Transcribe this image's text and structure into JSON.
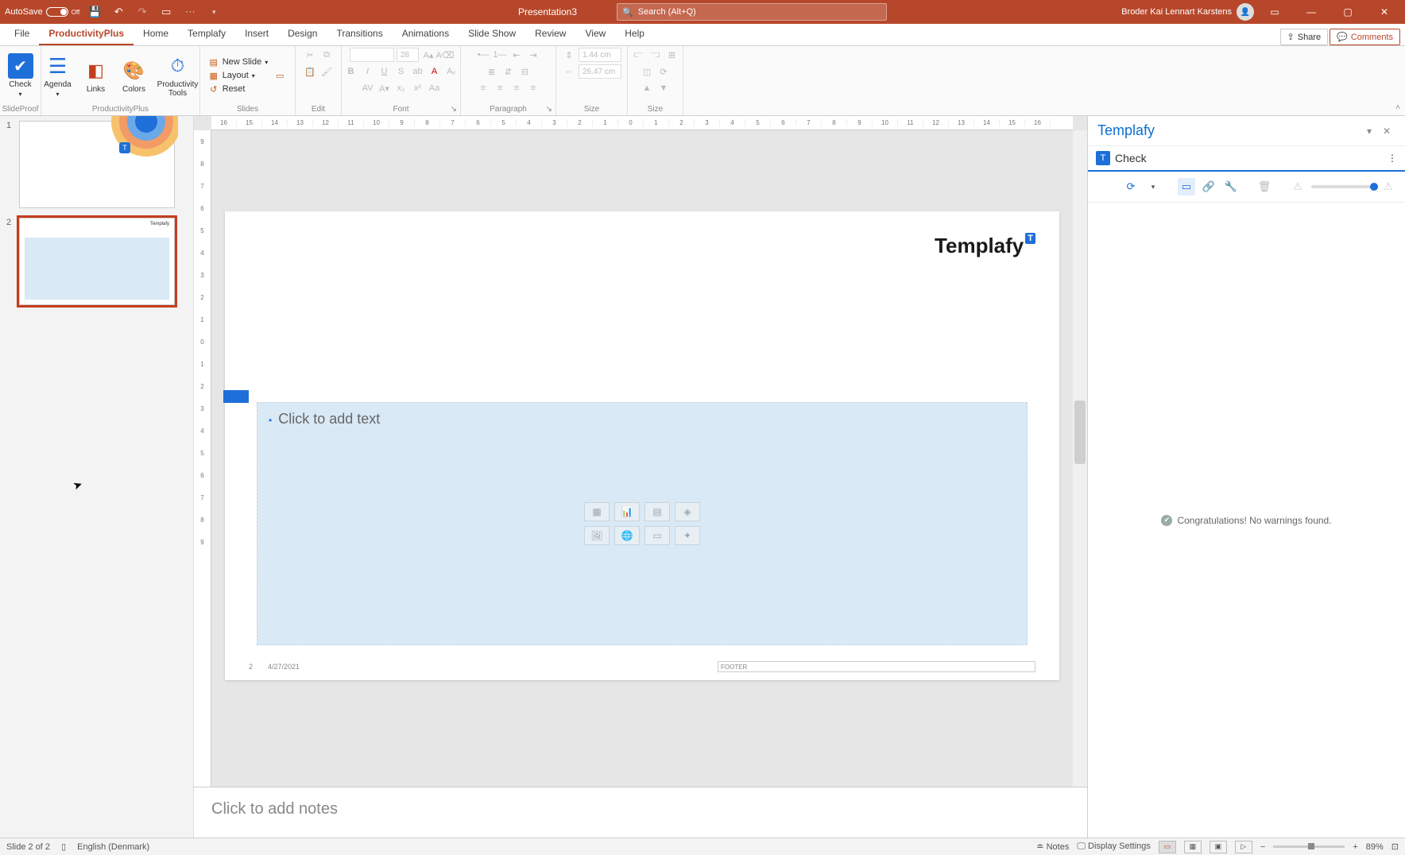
{
  "titlebar": {
    "autosave_label": "AutoSave",
    "autosave_state": "Off",
    "doc_title": "Presentation3",
    "search_placeholder": "Search (Alt+Q)",
    "user_name": "Broder Kai Lennart Karstens"
  },
  "tabs": {
    "items": [
      "File",
      "ProductivityPlus",
      "Home",
      "Templafy",
      "Insert",
      "Design",
      "Transitions",
      "Animations",
      "Slide Show",
      "Review",
      "View",
      "Help"
    ],
    "active_index": 1,
    "share": "Share",
    "comments": "Comments"
  },
  "ribbon": {
    "slideproof": {
      "group": "SlideProof",
      "check": "Check"
    },
    "productivity": {
      "group": "ProductivityPlus",
      "agenda": "Agenda",
      "links": "Links",
      "colors": "Colors",
      "tools": "Productivity Tools"
    },
    "slides": {
      "group": "Slides",
      "new_slide": "New Slide",
      "layout": "Layout",
      "reset": "Reset"
    },
    "edit_group": "Edit",
    "font": {
      "group": "Font",
      "size": "28"
    },
    "paragraph_group": "Paragraph",
    "size": {
      "group": "Size",
      "h": "1.44 cm",
      "w": "26.47 cm",
      "group2": "Size"
    }
  },
  "thumbs": {
    "items": [
      {
        "num": "1"
      },
      {
        "num": "2"
      }
    ],
    "selected_index": 1
  },
  "slide": {
    "logo": "Templafy",
    "placeholder_text": "Click to add text",
    "page_num": "2",
    "date": "4/27/2021",
    "footer_label": "FOOTER"
  },
  "ruler_h": [
    "16",
    "15",
    "14",
    "13",
    "12",
    "11",
    "10",
    "9",
    "8",
    "7",
    "6",
    "5",
    "4",
    "3",
    "2",
    "1",
    "0",
    "1",
    "2",
    "3",
    "4",
    "5",
    "6",
    "7",
    "8",
    "9",
    "10",
    "11",
    "12",
    "13",
    "14",
    "15",
    "16"
  ],
  "ruler_v": [
    "9",
    "8",
    "7",
    "6",
    "5",
    "4",
    "3",
    "2",
    "1",
    "0",
    "1",
    "2",
    "3",
    "4",
    "5",
    "6",
    "7",
    "8",
    "9"
  ],
  "notes": {
    "placeholder": "Click to add notes"
  },
  "side": {
    "title": "Templafy",
    "sub_title": "Check",
    "message": "Congratulations! No warnings found."
  },
  "status": {
    "slide_info": "Slide 2 of 2",
    "language": "English (Denmark)",
    "notes": "Notes",
    "display": "Display Settings",
    "zoom": "89%"
  }
}
